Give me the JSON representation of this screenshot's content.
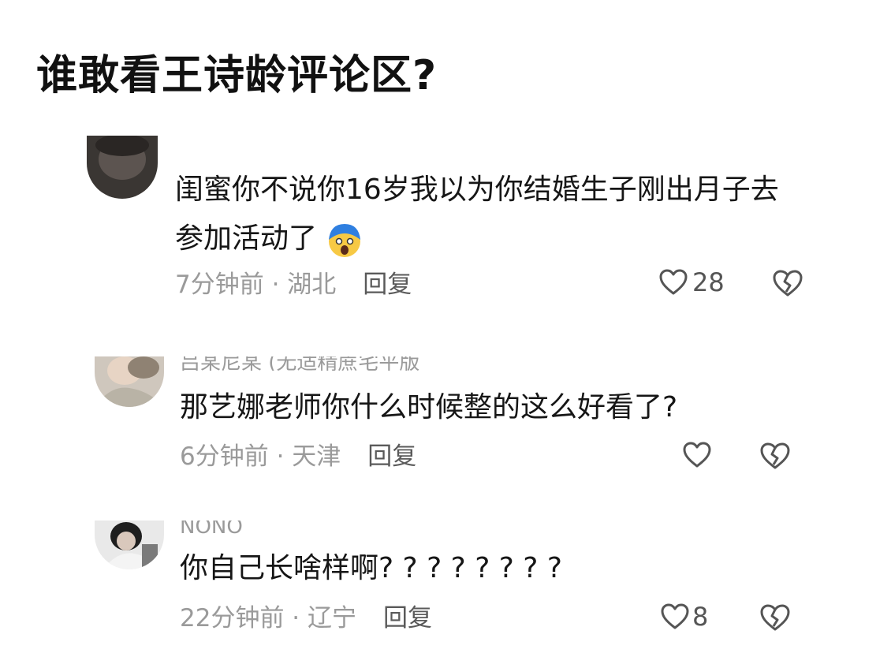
{
  "post": {
    "title": "谁敢看王诗龄评论区?"
  },
  "comments": [
    {
      "name": "",
      "text_line1": "闺蜜你不说你16岁我以为你结婚生子刚出月子去",
      "text_line2": "参加活动了",
      "emoji": "scream-face-emoji",
      "meta": "7分钟前 · 湖北",
      "reply": "回复",
      "likes": "28"
    },
    {
      "name": "吕某尼某 (无适精蔗宅平版",
      "text_line1": "那艺娜老师你什么时候整的这么好看了?",
      "meta": "6分钟前 · 天津",
      "reply": "回复",
      "likes": ""
    },
    {
      "name": "NONO",
      "text_line1": "你自己长啥样啊? ? ? ? ? ? ? ?",
      "meta": "22分钟前 · 辽宁",
      "reply": "回复",
      "likes": "8"
    }
  ],
  "icons": {
    "like": "heart-outline-icon",
    "dislike": "broken-heart-icon"
  },
  "colors": {
    "meta": "#9a9a9a",
    "text": "#161616",
    "icon": "#555555"
  }
}
